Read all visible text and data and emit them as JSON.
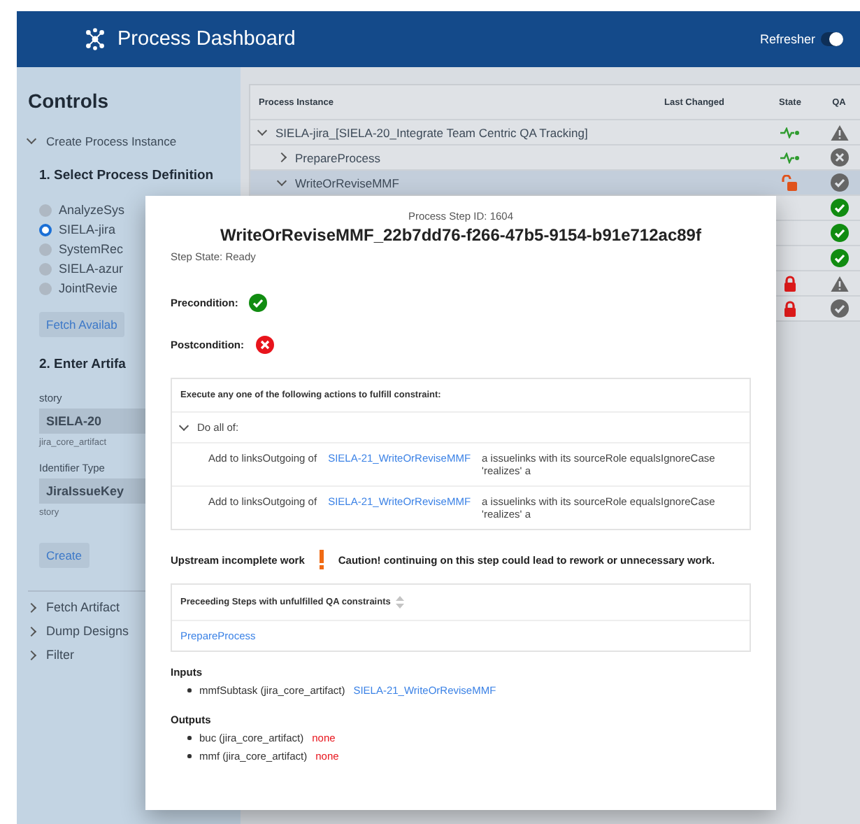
{
  "header": {
    "title": "Process Dashboard",
    "refresher": {
      "label": "Refresher",
      "on": true
    }
  },
  "sidebar": {
    "title": "Controls",
    "create_section": {
      "label": "Create Process Instance",
      "expanded": true
    },
    "step1": "1. Select Process Definition",
    "definitions": [
      {
        "label": "AnalyzeSys",
        "selected": false
      },
      {
        "label": "SIELA-jira",
        "selected": true
      },
      {
        "label": "SystemRec",
        "selected": false
      },
      {
        "label": "SIELA-azur",
        "selected": false
      },
      {
        "label": "JointRevie",
        "selected": false
      }
    ],
    "fetch_button": "Fetch Availab",
    "step2": "2. Enter Artifa",
    "fields": [
      {
        "label": "story",
        "value": "SIELA-20",
        "hint": "jira_core_artifact"
      },
      {
        "label": "Identifier Type",
        "value": "JiraIssueKey",
        "hint": "story"
      }
    ],
    "create_button": "Create",
    "sections": [
      {
        "label": "Fetch Artifact",
        "expanded": false
      },
      {
        "label": "Dump Designs",
        "expanded": false
      },
      {
        "label": "Filter",
        "expanded": false
      }
    ]
  },
  "table": {
    "columns": [
      "Process Instance",
      "Last Changed",
      "State",
      "QA"
    ],
    "rows": [
      {
        "label": "SIELA-jira_[SIELA-20_Integrate Team Centric QA Tracking]",
        "expanded": true,
        "selected": false,
        "state": {
          "kind": "running"
        },
        "qa": {
          "kind": "warning"
        },
        "children": [
          {
            "label": "PrepareProcess",
            "expanded": false,
            "selected": false,
            "state": {
              "kind": "running"
            },
            "qa": {
              "kind": "failed"
            }
          },
          {
            "label": "WriteOrReviseMMF",
            "expanded": true,
            "selected": true,
            "state": {
              "kind": "unlocked"
            },
            "qa": {
              "kind": "complete"
            },
            "children": [
              {
                "qa": {
                  "kind": "passed"
                }
              },
              {
                "qa": {
                  "kind": "passed"
                }
              },
              {
                "qa": {
                  "kind": "passed"
                }
              },
              {
                "state": {
                  "kind": "locked"
                },
                "qa": {
                  "kind": "warning"
                }
              },
              {
                "state": {
                  "kind": "locked"
                },
                "qa": {
                  "kind": "complete"
                }
              }
            ]
          }
        ]
      }
    ]
  },
  "dialog": {
    "step_id": "Process Step ID: 1604",
    "title": "WriteOrReviseMMF_22b7dd76-f266-47b5-9154-b91e712ac89f",
    "step_state": "Step State: Ready",
    "conditions": [
      {
        "label": "Precondition:",
        "fulfilled": true
      },
      {
        "label": "Postcondition:",
        "fulfilled": false
      }
    ],
    "constraint": {
      "title": "Execute any one of the following actions to fulfill constraint:",
      "group": {
        "label": "Do all of:",
        "expanded": true
      },
      "actions": [
        {
          "prefix": "Add to linksOutgoing of",
          "link": "SIELA-21_WriteOrReviseMMF",
          "suffix": "a issuelinks with its sourceRole equalsIgnoreCase 'realizes' a"
        },
        {
          "prefix": "Add to linksOutgoing of",
          "link": "SIELA-21_WriteOrReviseMMF",
          "suffix": "a issuelinks with its sourceRole equalsIgnoreCase 'realizes' a"
        }
      ]
    },
    "upstream": {
      "label": "Upstream incomplete work",
      "caution": "Caution! continuing on this step could lead to rework or unnecessary work."
    },
    "preceding": {
      "column": "Preceeding Steps with unfulfilled QA constraints",
      "rows": [
        "PrepareProcess"
      ]
    },
    "inputs": {
      "title": "Inputs",
      "items": [
        {
          "name": "mmfSubtask (jira_core_artifact)",
          "value": "SIELA-21_WriteOrReviseMMF",
          "kind": "link"
        }
      ]
    },
    "outputs": {
      "title": "Outputs",
      "items": [
        {
          "name": "buc (jira_core_artifact)",
          "value": "none",
          "kind": "missing"
        },
        {
          "name": "mmf (jira_core_artifact)",
          "value": "none",
          "kind": "missing"
        }
      ]
    }
  }
}
